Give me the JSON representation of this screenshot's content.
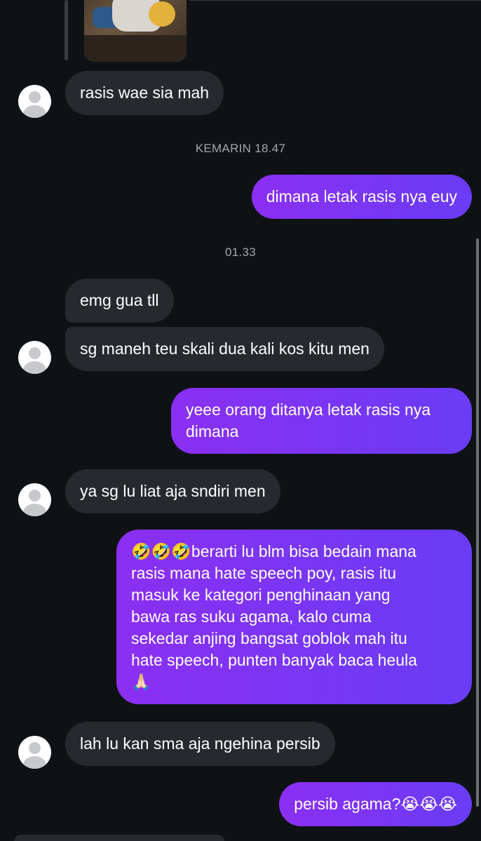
{
  "chat": {
    "timestamps": [
      "KEMARIN 18.47",
      "01.33"
    ],
    "messages": [
      {
        "dir": "in",
        "text": "rasis wae sia mah"
      },
      {
        "dir": "out",
        "text": "dimana letak rasis nya euy"
      },
      {
        "dir": "in",
        "text": "emg gua tll"
      },
      {
        "dir": "in",
        "text": "sg maneh teu skali dua kali kos kitu men"
      },
      {
        "dir": "out",
        "text": "yeee orang ditanya letak rasis nya\ndimana"
      },
      {
        "dir": "in",
        "text": "ya sg lu liat aja sndiri men"
      },
      {
        "dir": "out",
        "text": "🤣🤣🤣berarti lu blm bisa bedain mana\nrasis mana hate speech poy, rasis itu\nmasuk ke kategori penghinaan yang\nbawa ras suku agama, kalo cuma\nsekedar anjing bangsat goblok mah itu\nhate speech, punten banyak baca heula\n🙏🏻"
      },
      {
        "dir": "in",
        "text": "lah lu kan sma aja ngehina persib"
      },
      {
        "dir": "out",
        "text": "persib agama?😭😭😭"
      }
    ]
  },
  "colors": {
    "background": "#0f1215",
    "incoming_bubble": "#262a2f",
    "outgoing_bubble_start": "#8b2ff2",
    "outgoing_bubble_end": "#6a3cf5",
    "timestamp_text": "#a3a6ab"
  }
}
